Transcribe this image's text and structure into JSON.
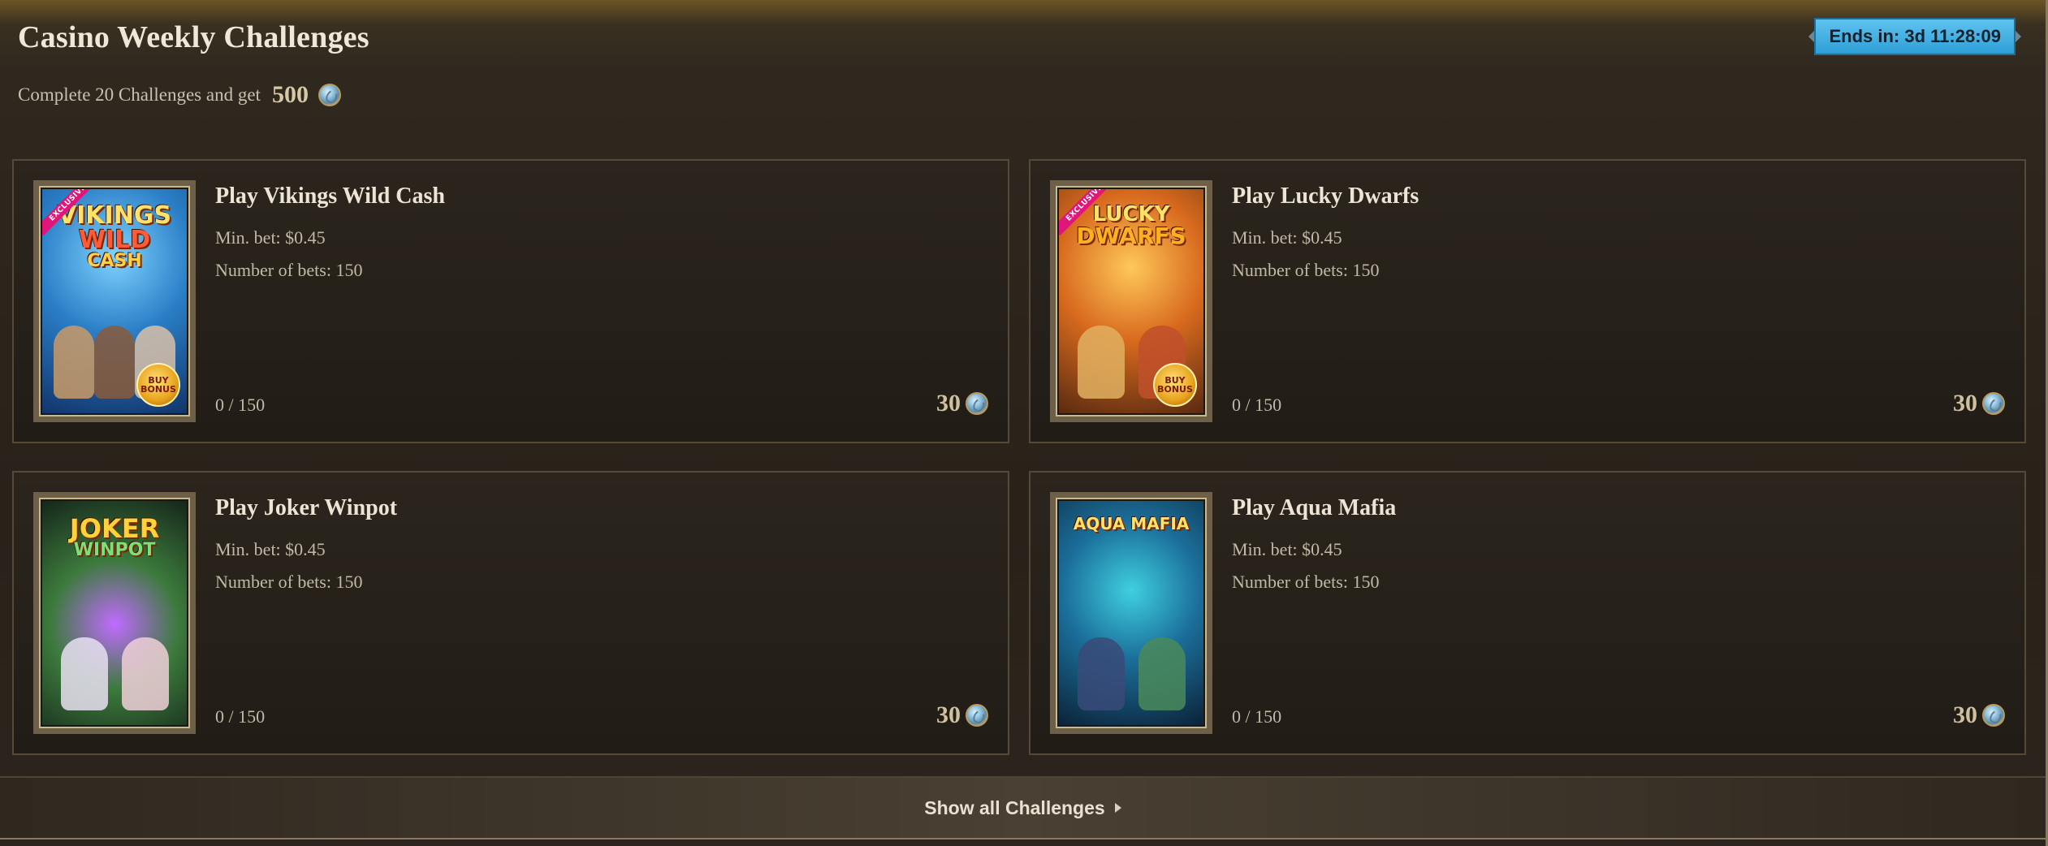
{
  "header": {
    "title": "Casino Weekly Challenges",
    "subtitle_prefix": "Complete 20 Challenges and get",
    "total_reward": "500",
    "timer": "Ends in: 3d 11:28:09"
  },
  "icons": {
    "coin": "coin-icon",
    "exclusive_badge": "exclusive-badge",
    "bonus_badge": "bonus-badge",
    "show_all_arrow": "caret-right-icon"
  },
  "challenges": [
    {
      "title": "Play Vikings Wild Cash",
      "min_bet": "Min. bet: $0.45",
      "num_bets": "Number of bets: 150",
      "progress": "0 / 150",
      "progress_fraction": 0,
      "reward": "30",
      "art_title": "VIKINGS",
      "art_title2": "WILD",
      "art_title3": "CASH",
      "badge_top": "EXCLUSIVE",
      "badge_bottom": "BUY BONUS"
    },
    {
      "title": "Play Lucky Dwarfs",
      "min_bet": "Min. bet: $0.45",
      "num_bets": "Number of bets: 150",
      "progress": "0 / 150",
      "progress_fraction": 0,
      "reward": "30",
      "art_title": "LUCKY",
      "art_title2": "DWARFS",
      "badge_top": "EXCLUSIVE",
      "badge_bottom": "BUY BONUS"
    },
    {
      "title": "Play Joker Winpot",
      "min_bet": "Min. bet: $0.45",
      "num_bets": "Number of bets: 150",
      "progress": "0 / 150",
      "progress_fraction": 0,
      "reward": "30",
      "art_title": "JOKER",
      "art_title2": "WINPOT"
    },
    {
      "title": "Play Aqua Mafia",
      "min_bet": "Min. bet: $0.45",
      "num_bets": "Number of bets: 150",
      "progress": "0 / 150",
      "progress_fraction": 0,
      "reward": "30",
      "art_title": "AQUA MAFIA"
    }
  ],
  "footer": {
    "show_all_label": "Show all Challenges"
  },
  "colors": {
    "background": "#2a241c",
    "timer_bg": "#2e9fd6",
    "card_border": "#55493a",
    "text_primary": "#ece4d4",
    "text_secondary": "#c2b9a7"
  }
}
